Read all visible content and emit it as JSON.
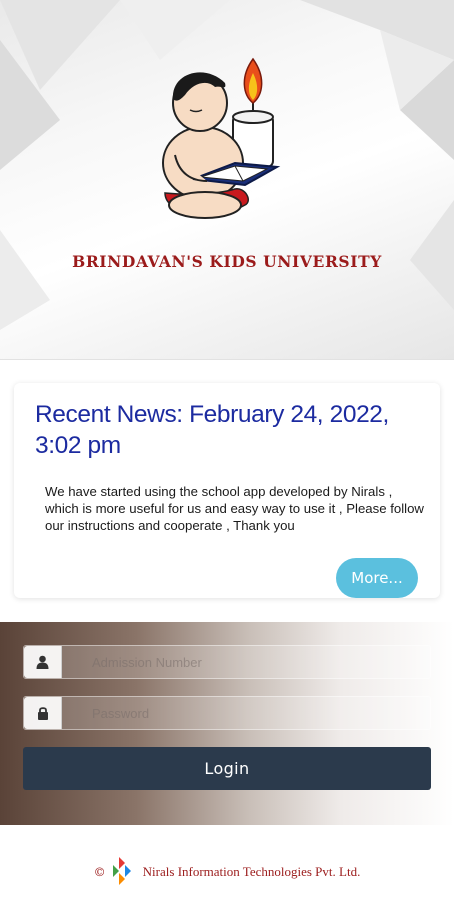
{
  "header": {
    "school_name": "BRINDAVAN'S KIDS UNIVERSITY",
    "logo": "child-reading-book-with-candle-logo"
  },
  "news": {
    "title": "Recent News: February 24, 2022, 3:02 pm",
    "body": "We have started using the school app developed by Nirals , which is more useful for us and easy way to use it , Please follow our instructions and cooperate , Thank you",
    "more_label": "More..."
  },
  "login": {
    "admission_placeholder": "Admission Number",
    "password_placeholder": "Password",
    "login_label": "Login",
    "user_icon": "user-icon",
    "lock_icon": "lock-icon"
  },
  "footer": {
    "copyright_symbol": "©",
    "company_name": "Nirals Information Technologies Pvt. Ltd."
  },
  "colors": {
    "brand_red": "#9b1b1b",
    "news_title_blue": "#1c2ba0",
    "more_button": "#5bc0de",
    "login_button": "#2b3a4c"
  }
}
